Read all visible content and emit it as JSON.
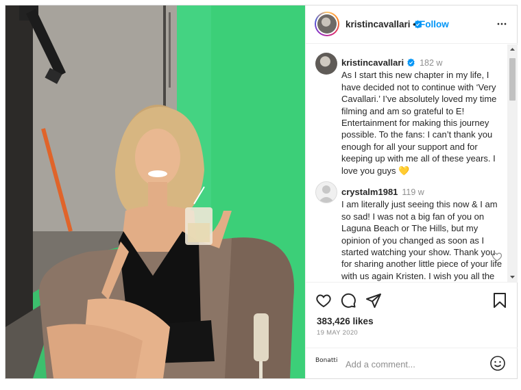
{
  "post": {
    "username": "kristincavallari",
    "follow_label": "Follow",
    "separator": "•"
  },
  "comments": [
    {
      "username": "kristincavallari",
      "time": "182 w",
      "text": "As I start this new chapter in my life, I have decided not to continue with ‘Very Cavallari.’ I’ve absolutely loved my time filming and am so grateful to E! Entertainment for making this journey possible. To the fans: I can’t thank you enough for all your support and for keeping up with me all of these years. I love you guys 💛"
    },
    {
      "username": "crystalm1981",
      "time": "119 w",
      "text": "I am literally just seeing this now & I am so sad! I was not a big fan of you on Laguna Beach or The Hills, but my opinion of you changed as soon as I started watching your show. Thank you for sharing another little piece of your life with us again Kristen. I wish you all the best!"
    }
  ],
  "stats": {
    "likes": "383,426 likes",
    "date": "19 MAY 2020"
  },
  "add_comment": {
    "brand_text": "Bonatti",
    "placeholder": "Add a comment..."
  },
  "colors": {
    "accent": "#0095f6",
    "muted": "#8e8e8e",
    "border": "#dbdbdb",
    "green_screen": "#2fbf6a"
  },
  "icons": [
    "more-icon",
    "verified-icon",
    "heart-icon",
    "comment-icon",
    "share-icon",
    "bookmark-icon",
    "emoji-icon",
    "small-heart-icon"
  ]
}
